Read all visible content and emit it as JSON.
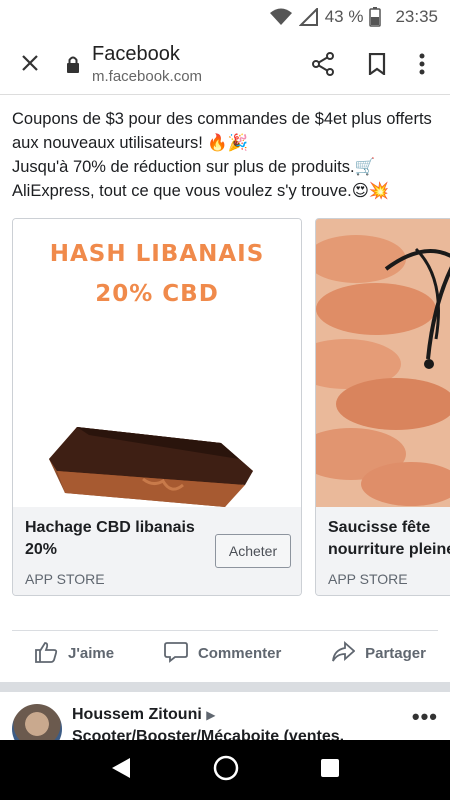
{
  "status_bar": {
    "battery": "43 %",
    "time": "23:35"
  },
  "browser": {
    "site_title": "Facebook",
    "url": "m.facebook.com"
  },
  "post": {
    "text_line1": "Coupons de $3 pour des commandes de $4et plus offerts aux nouveaux utilisateurs! 🔥🎉",
    "text_line2": "Jusqu'à 70% de réduction sur plus de produits.🛒",
    "text_line3": "AliExpress, tout ce que vous voulez s'y trouve.😍💥",
    "cards": [
      {
        "image_text_line1": "HASH LIBANAIS",
        "image_text_line2": "20% CBD",
        "name": "Hachage CBD libanais 20%",
        "source": "APP STORE",
        "button": "Acheter"
      },
      {
        "name": "Saucisse fête nourriture pleine",
        "source": "APP STORE"
      }
    ],
    "actions": {
      "like": "J'aime",
      "comment": "Commenter",
      "share": "Partager"
    }
  },
  "next_post": {
    "author": "Houssem Zitouni",
    "group": "Scooter/Booster/Mécaboite (ventes,"
  },
  "colors": {
    "hash_text": "#f08a4b",
    "facebook_text": "#1c1e21",
    "secondary_text": "#606770"
  },
  "icons": [
    "wifi-icon",
    "signal-icon",
    "battery-icon",
    "close-icon",
    "lock-icon",
    "share-icon",
    "bookmark-icon",
    "more-vertical-icon",
    "like-icon",
    "comment-icon",
    "share-arrow-icon",
    "more-horizontal-icon",
    "back-nav-icon",
    "home-nav-icon",
    "recents-nav-icon"
  ]
}
